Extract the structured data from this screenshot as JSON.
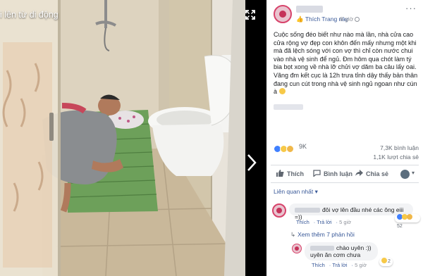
{
  "viewer": {
    "album_label": "i lên từ di động",
    "icons": {
      "expand": "expand-icon",
      "next": "chevron-right-icon"
    }
  },
  "post": {
    "like_page": "Thích Trang này",
    "time": "8 giờ",
    "more": "···",
    "caption": "Cuộc sống đéo biết như nào mà lần, nhà cửa cao cửa rộng vợ đẹp con khôn đến mấy nhưng một khi mà đã lệch sóng với con vợ thì chỉ còn nước chui vào nhà vệ sinh để ngủ. Đm hôm qua chót làm tý bia bọt xong về nhà lỡ chửi vợ dăm ba câu lấy oai. Vãng đm kết cục là 12h trưa tỉnh dậy thấy bản thân đang cun cút trong nhà vệ sinh ngủ ngoan như cún à",
    "reactions_count": "9K",
    "comments_count": "7,3K bình luận",
    "shares_count": "1,1K lượt chia sẻ",
    "colors": {
      "link": "#385898",
      "like": "#4080ff",
      "muted": "#606770"
    }
  },
  "actions": {
    "like": "Thích",
    "comment": "Bình luận",
    "share": "Chia sẻ",
    "caret": "▾"
  },
  "comments": {
    "sort_label": "Liên quan nhất ▾",
    "first": {
      "text": "đôi vợ lên đầu nhé các ông eiii =))",
      "react_count": "52",
      "like": "Thích",
      "reply": "Trả lời",
      "time": "5 giờ"
    },
    "more_replies": "Xem thêm 7 phản hồi",
    "reply": {
      "text": "chào uyên :)) uyên ăn cơm chưa",
      "react_count": "2",
      "like": "Thích",
      "reply_label": "Trả lời",
      "time": "5 giờ"
    }
  }
}
